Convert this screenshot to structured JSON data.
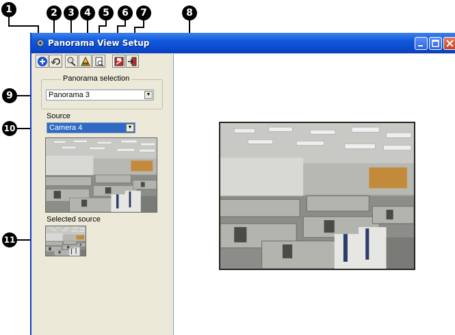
{
  "window": {
    "title": "Panorama View Setup"
  },
  "callouts": [
    "1",
    "2",
    "3",
    "4",
    "5",
    "6",
    "7",
    "8",
    "9",
    "10",
    "11"
  ],
  "toolbar": {
    "buttons": [
      {
        "icon": "add-panorama-icon"
      },
      {
        "icon": "undo-icon"
      },
      {
        "icon": "edit-panorama-icon"
      },
      {
        "icon": "color-panorama-icon"
      },
      {
        "icon": "preview-icon"
      },
      {
        "icon": "save-icon"
      },
      {
        "icon": "exit-icon"
      }
    ]
  },
  "panorama_selection": {
    "legend": "Panorama selection",
    "value": "Panorama 3"
  },
  "source": {
    "label": "Source",
    "value": "Camera 4"
  },
  "selected_source": {
    "label": "Selected source"
  },
  "colors": {
    "titlebar": "#0c4bd0",
    "selection": "#316ac5",
    "panel": "#ece9d8"
  }
}
